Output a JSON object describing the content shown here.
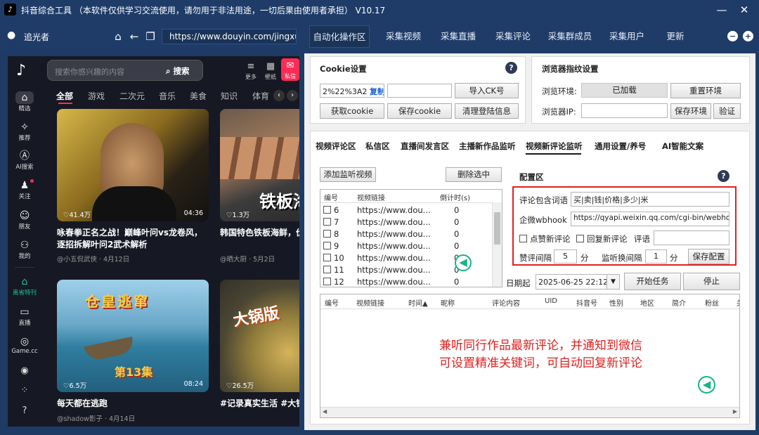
{
  "window": {
    "title": "抖音综合工具 （本软件仅供学习交流使用，请勿用于非法用途，一切后果由使用者承担） V10.17",
    "minimize": "—",
    "close": "✕"
  },
  "navbar": {
    "user": "追光者",
    "url": "https://www.douyin.com/jingxuan",
    "tabs": [
      "自动化操作区",
      "采集视频",
      "采集直播",
      "采集评论",
      "采集群成员",
      "采集用户",
      "更新"
    ],
    "active_tab": 0
  },
  "douyin": {
    "logo": "♪",
    "rail": [
      {
        "icon": "home-icon",
        "glyph": "⌂",
        "label": "精选"
      },
      {
        "icon": "sparkle-icon",
        "glyph": "✧",
        "label": "推荐"
      },
      {
        "icon": "ai-icon",
        "glyph": "Ⓐ",
        "label": "AI搜索"
      },
      {
        "icon": "follow-icon",
        "glyph": "♟",
        "label": "关注"
      },
      {
        "icon": "friends-icon",
        "glyph": "☺",
        "label": "朋友"
      },
      {
        "icon": "person-icon",
        "glyph": "⚇",
        "label": "我的"
      },
      {
        "icon": "drama-icon",
        "glyph": "⌂",
        "label": "离省特刊"
      },
      {
        "icon": "live-icon",
        "glyph": "▭",
        "label": "直播"
      },
      {
        "icon": "game-icon",
        "glyph": "◎",
        "label": "Game.cc"
      }
    ],
    "rail_bottom": [
      "◉",
      "⁘",
      "?"
    ],
    "search_placeholder": "搜索你感兴趣的内容",
    "search_button": "搜索",
    "top_actions": [
      {
        "glyph": "≡",
        "label": "更多"
      },
      {
        "glyph": "▦",
        "label": "壁纸"
      },
      {
        "glyph": "✉",
        "label": "私信"
      }
    ],
    "categories": [
      "全部",
      "游戏",
      "二次元",
      "音乐",
      "美食",
      "知识",
      "体育"
    ],
    "cards": [
      {
        "likes": "♡41.4万",
        "duration": "04:36",
        "title": "咏春拳正名之战！巅峰叶问vs龙卷风，逐招拆解叶问2武术解析",
        "author": "@小五侃武侠 · 4月12日",
        "overlay": ""
      },
      {
        "likes": "♡1.3万",
        "duration": "",
        "title": "韩国特色铁板海鲜，价满了荷包",
        "author": "@晒大厨 · 5月2日",
        "overlay": "铁板海"
      },
      {
        "likes": "♡6.5万",
        "duration": "08:24",
        "title": "每天都在逃跑",
        "author": "@shadow影子 · 4月14日",
        "overlay": "仓皇逃窜",
        "overlay2": "第13集"
      },
      {
        "likes": "♡26.5万",
        "duration": "",
        "title": "#记录真实生活 #大锅饭就是香",
        "author": "",
        "overlay": "大锅版"
      }
    ]
  },
  "cookie": {
    "title": "Cookie设置",
    "value": "2%22%3A2",
    "copy": "复制",
    "import": "导入CK号",
    "get": "获取cookie",
    "save": "保存cookie",
    "clear": "清理登陆信息"
  },
  "fingerprint": {
    "title": "浏览器指纹设置",
    "env_label": "浏览环境:",
    "env_value": "已加载",
    "reset": "重置环境",
    "ip_label": "浏览器IP:",
    "save_env": "保存环境",
    "verify": "验证"
  },
  "subtabs": [
    "视频评论区",
    "私信区",
    "直播间发言区",
    "主播新作品监听",
    "视频新评论监听",
    "通用设置/养号",
    "AI智能文案"
  ],
  "active_subtab": 4,
  "monitor": {
    "add": "添加监听视频",
    "delete": "删除选中",
    "headers": [
      "编号",
      "视频链接",
      "倒计时(s)"
    ],
    "rows": [
      {
        "id": "6",
        "url": "https://www.dou...",
        "cd": "0"
      },
      {
        "id": "7",
        "url": "https://www.dou...",
        "cd": "0"
      },
      {
        "id": "8",
        "url": "https://www.dou...",
        "cd": "0"
      },
      {
        "id": "9",
        "url": "https://www.dou...",
        "cd": "0"
      },
      {
        "id": "10",
        "url": "https://www.dou...",
        "cd": "0"
      },
      {
        "id": "11",
        "url": "https://www.dou...",
        "cd": "0"
      },
      {
        "id": "12",
        "url": "https://www.dou...",
        "cd": "0"
      }
    ]
  },
  "config": {
    "title": "配置区",
    "keywords_label": "评论包含词语",
    "keywords": "买|卖|钱|价格|多少|米",
    "webhook_label": "企微wbhook",
    "webhook": "https://qyapi.weixin.qq.com/cgi-bin/webhook",
    "like_new": "点赞新评论",
    "reply_new": "回复新评论",
    "reply_label": "评语",
    "like_interval_label": "赞评间隔",
    "like_interval": "5",
    "unit": "分",
    "listen_interval_label": "监听换间隔",
    "listen_interval": "1",
    "save": "保存配置"
  },
  "run": {
    "date_label": "日期起",
    "date": "2025-06-25 22:12",
    "start": "开始任务",
    "stop": "停止"
  },
  "results": {
    "headers": [
      "编号",
      "视频链接",
      "时间▲",
      "昵称",
      "评论内容",
      "UID",
      "抖音号",
      "性别",
      "地区",
      "简介",
      "粉丝",
      "关"
    ]
  },
  "annotation": {
    "line1": "兼听同行作品最新评论，并通知到微信",
    "line2": "可设置精准关键词，可自动回复新评论"
  },
  "colors": {
    "titlebar": "#1f3c69",
    "highlight": "#e02020",
    "annotation": "#e02020",
    "arrow": "#19b388"
  }
}
